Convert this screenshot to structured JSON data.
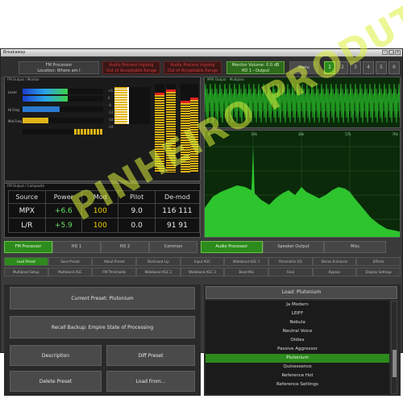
{
  "window": {
    "title": "Breakaway"
  },
  "topbar": {
    "status_lines": [
      "FM Processor",
      "Location: Where am I"
    ],
    "alert1": [
      "Audio Process Ingoing",
      "Out of Acceptable Range"
    ],
    "alert2": [
      "Audio Process Ingoing",
      "Out of Acceptable Range"
    ],
    "monitor_lines": [
      "Monitor Volume: 0.0 dB",
      "HD 1 - Output"
    ],
    "menu_label": "Menu",
    "numbers": [
      "1",
      "2",
      "3",
      "4",
      "5",
      "6"
    ]
  },
  "meters": {
    "label": "FM Output / Monitor",
    "row_labels": [
      "Level",
      "Hi Freq",
      "Mid Freq"
    ],
    "scale": [
      "+6",
      "0",
      "-6",
      "-12",
      "-18",
      "-24"
    ]
  },
  "scope": {
    "label": "MPX Output - Multiplex"
  },
  "spectrum": {
    "freq_labels": [
      "0",
      "19k",
      "38k",
      "57k",
      "76k"
    ]
  },
  "stats": {
    "label": "FM Output / Composite",
    "headers": [
      "Source",
      "Power",
      "Mod",
      "Pilot",
      "De-mod"
    ],
    "rows": [
      [
        "MPX",
        "+6.6",
        "100",
        "9.0",
        "116 111"
      ],
      [
        "L/R",
        "+5.9",
        "100",
        "0.0",
        "91 91"
      ]
    ]
  },
  "tabs_left": [
    "FM Processor",
    "HD 1",
    "HD 2",
    "Common"
  ],
  "tabs_right": [
    "Audio Processor",
    "Speaker Output",
    "Misc"
  ],
  "subrow1": [
    "Load Preset",
    "Save Preset",
    "About Preset",
    "Dominant Lip",
    "Input AGC",
    "Wideband AGC 1",
    "Parametric EQ",
    "Stereo Enhancer",
    "Effects"
  ],
  "subrow2": [
    "Multiband Setup",
    "Multiband AGC",
    "FM Thresholds",
    "Wideband AGC 2",
    "Wideband AGC 3",
    "Band Mix",
    "Final",
    "Bypass",
    "Display Settings"
  ],
  "left_panel": {
    "current_preset": "Current Preset: Plutonium",
    "recall_backup": "Recall Backup: Empire State of Processing",
    "description": "Description",
    "diff_preset": "Diff Preset",
    "delete_preset": "Delete Preset",
    "load_from": "Load From..."
  },
  "presets": {
    "header": "Load: Plutonium",
    "items": [
      "Ja Modern",
      "LEIFF",
      "Nebula",
      "Neutral Voice",
      "Oldies",
      "Passive Aggressor",
      "Plutonium",
      "Quinessence",
      "Reference Hot",
      "Reference Settings"
    ],
    "selected": "Plutonium"
  },
  "watermark": "PINHEIRO PRODUTOS",
  "colors": {
    "accent_green": "#2d8a1c",
    "alert_red": "#d43c3c",
    "meter_yellow": "#e0b418"
  }
}
